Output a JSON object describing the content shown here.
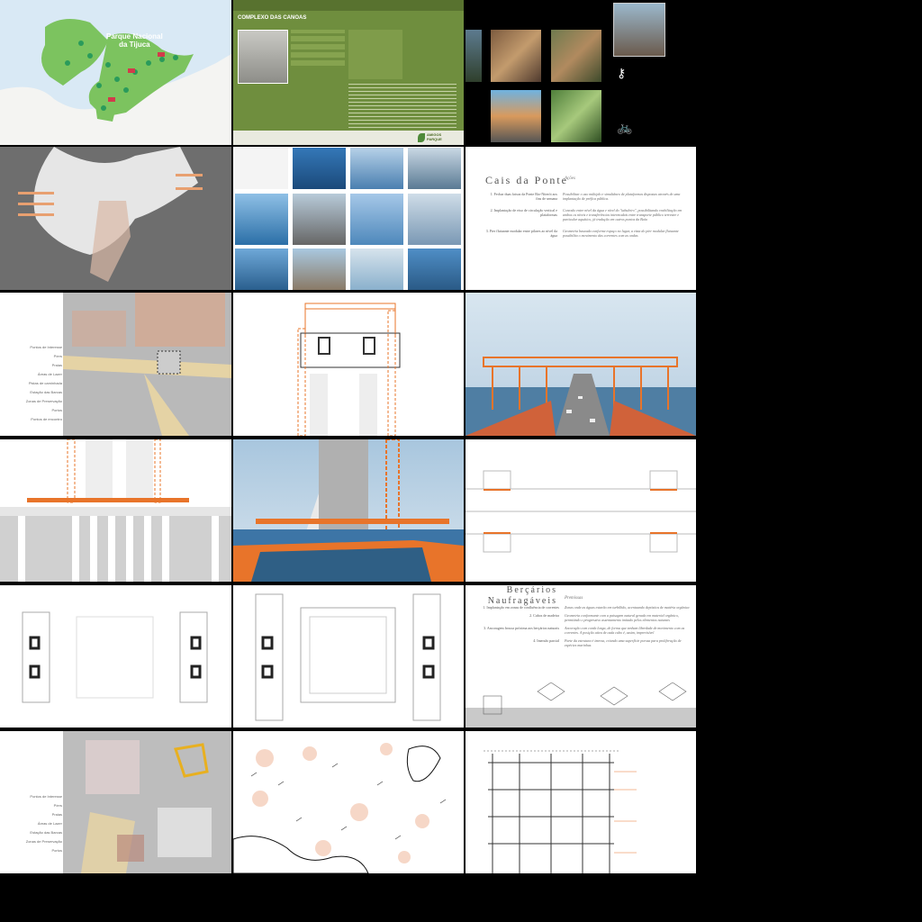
{
  "map_tile": {
    "park_label_line1": "Parque Nacional",
    "park_label_line2": "da Tijuca"
  },
  "web_tile": {
    "section_title": "COMPLEXO DAS CANOAS",
    "footer_brand_1": "AMIGOS",
    "footer_brand_2": "PARQUE"
  },
  "text_slide_1": {
    "title": "Cais da Ponte",
    "heading": "Ações",
    "items": [
      {
        "label": "1. Fechar duas faixas da Ponte Rio-Niterói aos fins de semana",
        "text": "Possibilitar o uso múltiplo e simultâneo de plataformas dispostas através de uma implantação de préfica pública."
      },
      {
        "label": "2. Implantação de eixo de circulação vertical e plataformas",
        "text": "Conexão entre nível da água e nível do \"tabuleiro\", possibilitando reabilitação em ambos os níveis e transferências intermodais entre transporte público terrestre e particular aquático, já tradução em outros pontos da Baía"
      },
      {
        "label": "3. Pier flutuante modular entre pilares ao nível da água",
        "text": "Geometria baseada conforme espaço no lugar, a vista do pier modular flutuante possibilita o movimento das correntes com as ondas"
      }
    ]
  },
  "text_slide_2": {
    "title_line1": "Berçários",
    "title_line2": "Naufragáveis",
    "heading": "Premissas",
    "items": [
      {
        "label": "1. Implantação em zonas de confluência de correntes",
        "text": "Zonas onde as águas estarão em turbilhão, acentuando depósitos de matéria orgânica"
      },
      {
        "label": "2. Cubos de madeira",
        "text": "Geometria conformante com a paisagem natural gerada em material orgânico, permitindo o progressivo assentamento imitado pelos elementos naturais"
      },
      {
        "label": "3. Ancoragem frouxa próxima aos berçários naturais",
        "text": "Ancoração com corda longa, de forma que tenham liberdade de movimento com as correntes. A posição ativa de cada cubo é, assim, imprevisível"
      },
      {
        "label": "4. Imersão parcial",
        "text": "Parte da estrutura é imersa, criando uma superfície porosa para proliferação de espécies marinhas"
      }
    ]
  },
  "legend_labels": [
    "Pontos de Interesse",
    "Píers",
    "Praias",
    "Áreas de Lazer",
    "Pistas de caminhada",
    "Estação das Barcas",
    "Zonas de Preservação",
    "Portos",
    "Pontos de encontro"
  ],
  "colors": {
    "orange": "#e8742a",
    "map_green": "#79c35a",
    "web_green": "#6d8c3c",
    "water_blue": "#3f8fd0",
    "sky": "#cfe0ee"
  },
  "icons": [
    "map-pin-icon",
    "key-icon",
    "bicycle-icon",
    "leaf-icon"
  ]
}
